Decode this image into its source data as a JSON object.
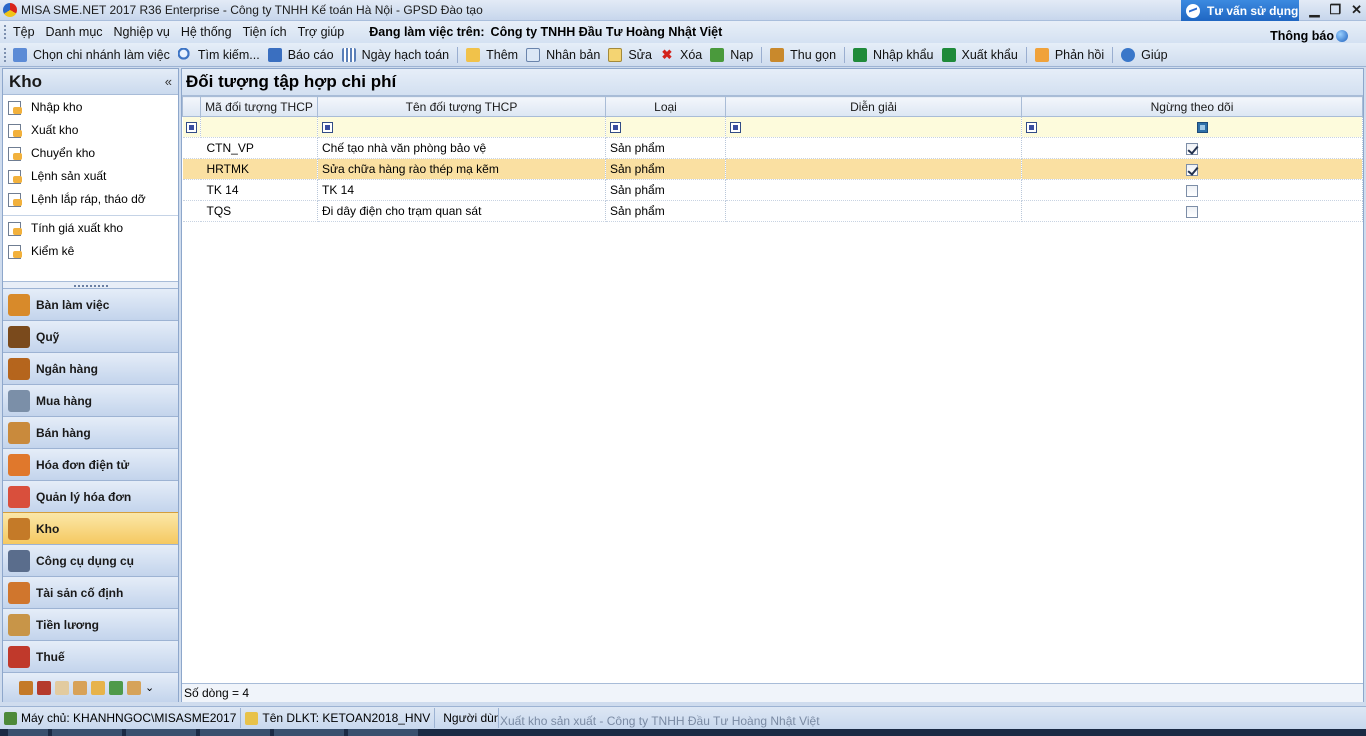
{
  "titlebar": {
    "title": "MISA SME.NET 2017 R36 Enterprise - Công ty TNHH Kế toán Hà Nội - GPSD Đào tạo",
    "tuvan": "Tư vấn sử dụng",
    "min": "▁",
    "max": "❐",
    "close": "✕"
  },
  "menubar": {
    "items": [
      "Tệp",
      "Danh mục",
      "Nghiệp vụ",
      "Hệ thống",
      "Tiện ích",
      "Trợ giúp"
    ],
    "working_label": "Đang làm việc trên:",
    "company": "Công ty TNHH Đầu Tư Hoàng Nhật Việt",
    "thongbao": "Thông báo"
  },
  "toolbar": {
    "branch": "Chọn chi nhánh làm việc",
    "search": "Tìm kiếm...",
    "report": "Báo cáo",
    "date": "Ngày hạch toán",
    "add": "Thêm",
    "duplicate": "Nhân bản",
    "edit": "Sửa",
    "delete": "Xóa",
    "reload": "Nạp",
    "compact": "Thu gọn",
    "import": "Nhập khẩu",
    "export": "Xuất khẩu",
    "feedback": "Phản hồi",
    "help": "Giúp"
  },
  "left": {
    "title": "Kho",
    "collapse": "«",
    "items": [
      "Nhập kho",
      "Xuất kho",
      "Chuyển kho",
      "Lệnh sản xuất",
      "Lệnh lắp ráp, tháo dỡ",
      "Tính giá xuất kho",
      "Kiểm kê"
    ],
    "nav": [
      {
        "label": "Bàn làm việc",
        "color": "#d88a2a"
      },
      {
        "label": "Quỹ",
        "color": "#7a4a1c"
      },
      {
        "label": "Ngân hàng",
        "color": "#b5651d"
      },
      {
        "label": "Mua hàng",
        "color": "#7b8fa8"
      },
      {
        "label": "Bán hàng",
        "color": "#c98a3c"
      },
      {
        "label": "Hóa đơn điện tử",
        "color": "#e0782c"
      },
      {
        "label": "Quản lý hóa đơn",
        "color": "#d94f3c"
      },
      {
        "label": "Kho",
        "color": "#c47a28"
      },
      {
        "label": "Công cụ dụng cụ",
        "color": "#5a6d8c"
      },
      {
        "label": "Tài sản cố định",
        "color": "#d0762d"
      },
      {
        "label": "Tiền lương",
        "color": "#c89548"
      },
      {
        "label": "Thuế",
        "color": "#c0392b"
      }
    ]
  },
  "main": {
    "title": "Đối tượng tập hợp chi phí",
    "columns": [
      "Mã đối tượng THCP",
      "Tên đối tượng THCP",
      "Loại",
      "Diễn giải",
      "Ngừng theo dõi"
    ],
    "rows": [
      {
        "code": "CTN_VP",
        "name": "Chế tạo nhà văn phòng bảo vệ",
        "type": "Sản phẩm",
        "desc": "",
        "stopped": true
      },
      {
        "code": "HRTMK",
        "name": "Sửa chữa hàng rào thép mạ kẽm",
        "type": "Sản phẩm",
        "desc": "",
        "stopped": true
      },
      {
        "code": "TK 14",
        "name": "TK 14",
        "type": "Sản phẩm",
        "desc": "",
        "stopped": false
      },
      {
        "code": "TQS",
        "name": "Đi dây điện cho trạm quan sát",
        "type": "Sản phẩm",
        "desc": "",
        "stopped": false
      }
    ],
    "selected_row": 1,
    "row_count": "Số dòng = 4"
  },
  "taskbar": {
    "server": "Máy chủ: KHANHNGOC\\MISASME2017",
    "db": "Tên DLKT: KETOAN2018_HNV",
    "user": "Người dùn",
    "subwindow": "Xuất kho sản xuất - Công ty TNHH Đầu Tư Hoàng Nhật Việt"
  },
  "colors": {
    "accent": "#1f66c2",
    "selected_row": "#fae0a2",
    "active_nav": "#f5c961"
  }
}
